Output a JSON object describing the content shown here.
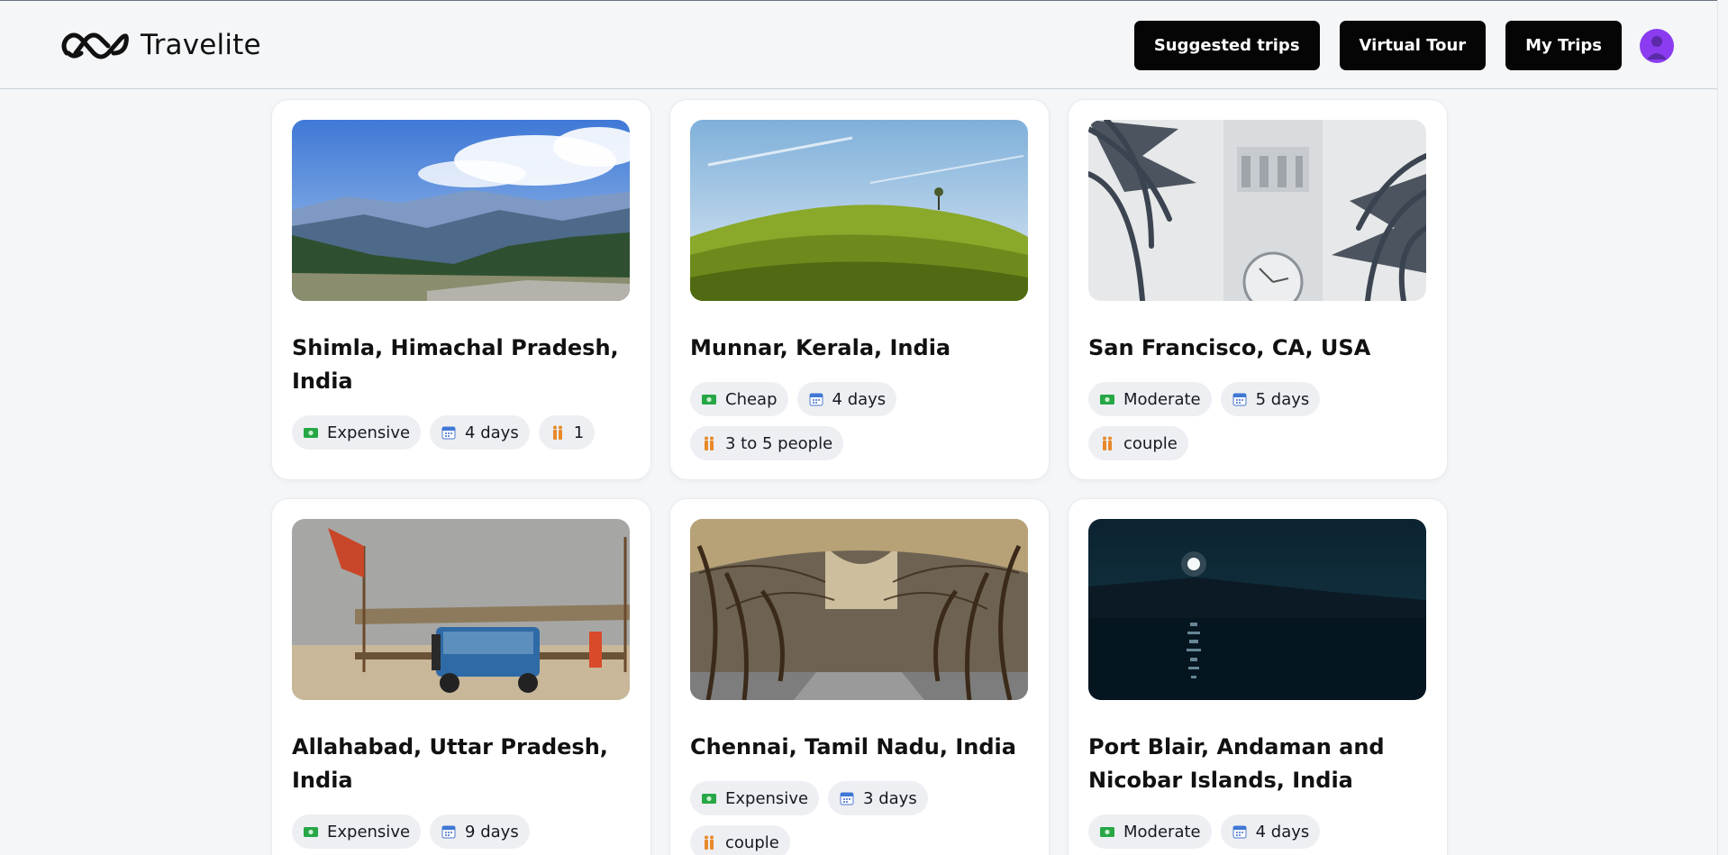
{
  "header": {
    "brand": "Travelite",
    "nav": {
      "suggested": "Suggested trips",
      "virtual": "Virtual Tour",
      "mytrips": "My Trips"
    }
  },
  "trips": [
    {
      "title": "Shimla, Himachal Pradesh, India",
      "budget": "Expensive",
      "days": "4 days",
      "travelers": "1"
    },
    {
      "title": "Munnar, Kerala, India",
      "budget": "Cheap",
      "days": "4 days",
      "travelers": "3 to 5 people"
    },
    {
      "title": "San Francisco, CA, USA",
      "budget": "Moderate",
      "days": "5 days",
      "travelers": "couple"
    },
    {
      "title": "Allahabad, Uttar Pradesh, India",
      "budget": "Expensive",
      "days": "9 days",
      "travelers": ""
    },
    {
      "title": "Chennai, Tamil Nadu, India",
      "budget": "Expensive",
      "days": "3 days",
      "travelers": "couple"
    },
    {
      "title": "Port Blair, Andaman and Nicobar Islands, India",
      "budget": "Moderate",
      "days": "4 days",
      "travelers": ""
    }
  ]
}
